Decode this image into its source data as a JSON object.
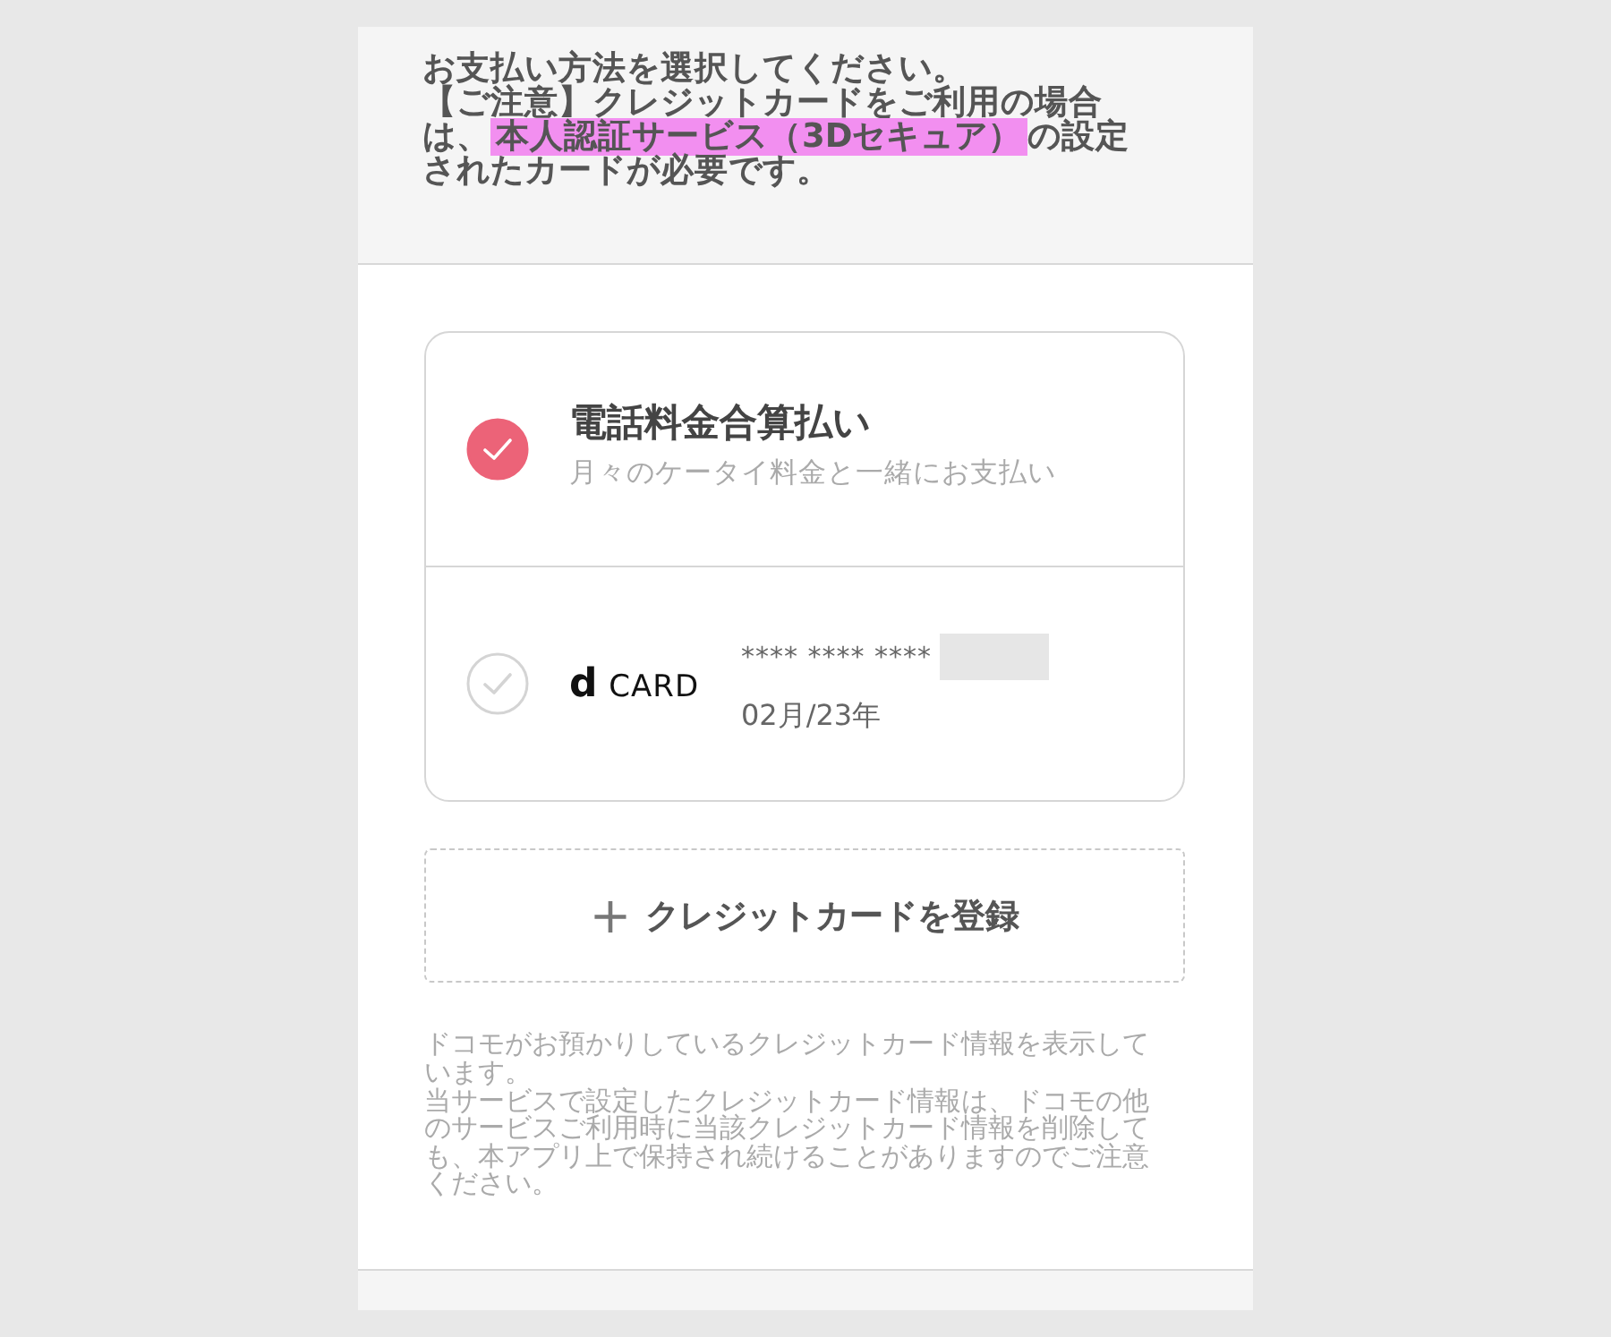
{
  "notice": {
    "lines": [
      [
        {
          "text": "お支払い方法を選択してください。",
          "highlight": false
        }
      ],
      [
        {
          "text": "【ご注意】クレジットカードをご利用の場合",
          "highlight": false
        }
      ],
      [
        {
          "text": "は、",
          "highlight": false
        },
        {
          "text": "本人認証サービス（3Dセキュア）",
          "highlight": true
        },
        {
          "text": "の設定",
          "highlight": false
        }
      ],
      [
        {
          "text": "されたカードが必要です。",
          "highlight": false
        }
      ]
    ]
  },
  "payment_options": [
    {
      "kind": "carrier",
      "selected": true,
      "title": "電話料金合算払い",
      "subtitle": "月々のケータイ料金と一緒にお支払い"
    },
    {
      "kind": "card",
      "selected": false,
      "logo_mark": "d",
      "logo_text": "CARD",
      "number": "**** **** ****",
      "expiry": "02月/23年"
    }
  ],
  "add_card_button": {
    "icon": "+",
    "label": "クレジットカードを登録"
  },
  "footnote": {
    "paragraphs": [
      [
        "ドコモがお預かりしているクレジットカード情報を表示して",
        "います。"
      ],
      [
        "当サービスで設定したクレジットカード情報は、ドコモの他",
        "のサービスご利用時に当該クレジットカード情報を削除して",
        "も、本アプリ上で保持され続けることがありますのでご注意",
        "ください。"
      ]
    ]
  }
}
